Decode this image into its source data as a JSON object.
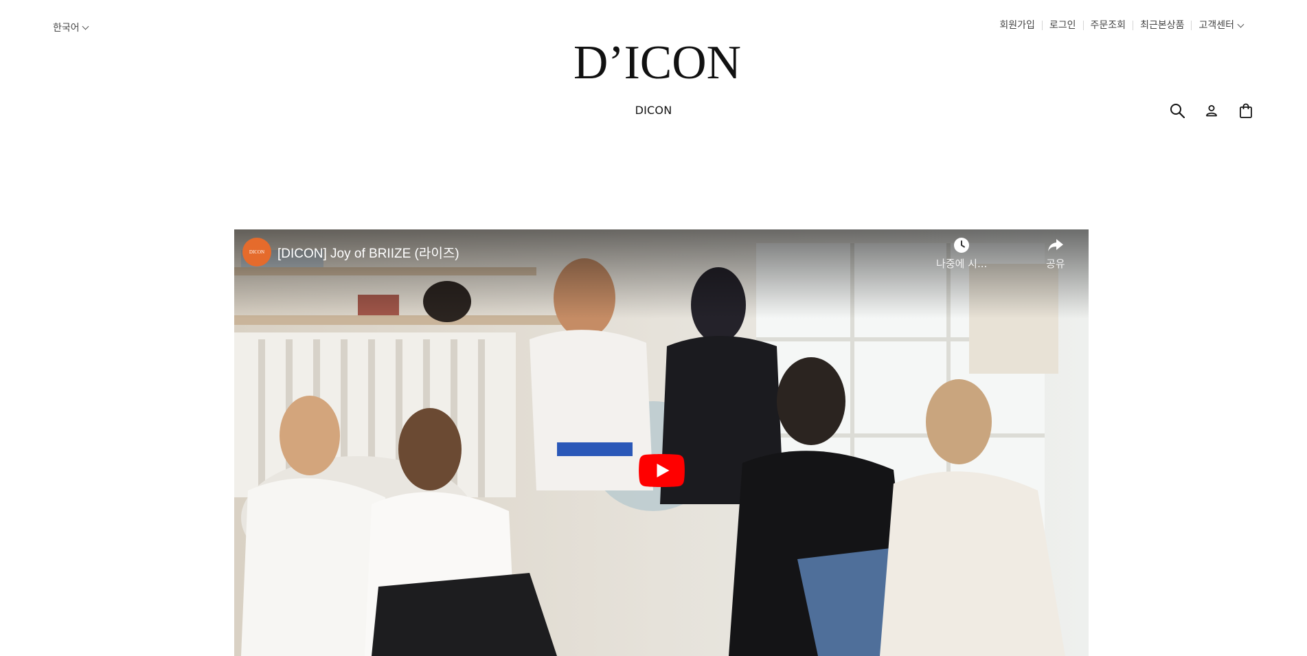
{
  "header": {
    "language": "한국어",
    "top_links": [
      "회원가입",
      "로그인",
      "주문조회",
      "최근본상품",
      "고객센터"
    ],
    "logo_text": "D’ICON",
    "nav_label": "DICON"
  },
  "icons": [
    "search-icon",
    "user-icon",
    "shopping-bag-icon",
    "chevron-down-icon"
  ],
  "video": {
    "channel_avatar_text": "DICON",
    "title": "[DICON] Joy of BRIIZE (라이즈)",
    "watch_later_label": "나중에 시...",
    "share_label": "공유"
  },
  "colors": {
    "channel_avatar": "#e56b2c",
    "play_button": "#ff0000",
    "background": "#ffffff"
  }
}
